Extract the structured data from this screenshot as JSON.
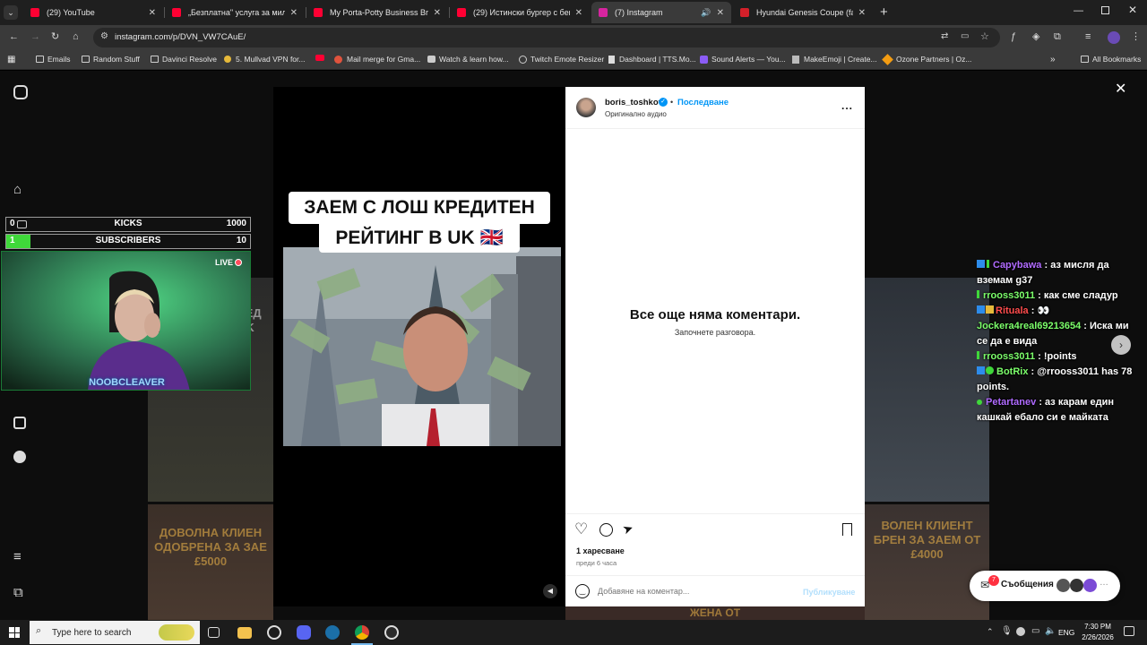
{
  "tabs": [
    {
      "label": "(29) YouTube",
      "color": "#ff0033"
    },
    {
      "label": "„Безплатна\" услуга за милион...",
      "color": "#ff0033"
    },
    {
      "label": "My Porta-Potty Business Brings...",
      "color": "#ff0033"
    },
    {
      "label": "(29) Истински бургер с бекон...",
      "color": "#ff0033"
    },
    {
      "label": "(7) Instagram",
      "color": "#d6249f"
    },
    {
      "label": "Hyundai Genesis Coupe (facelift...",
      "color": "#d4202a"
    }
  ],
  "new_tab": "+",
  "address": {
    "url": "instagram.com/p/DVN_VW7CAuE/"
  },
  "bookmarks": [
    "Emails",
    "Random Stuff",
    "Davinci Resolve",
    "5. Mullvad VPN for...",
    "Mail merge for Gma...",
    "Watch & learn how...",
    "Twitch Emote Resizer",
    "Dashboard | TTS.Mo...",
    "Sound Alerts — You...",
    "MakeEmoji | Create...",
    "Ozone Partners | Oz..."
  ],
  "bookmarks_all": "All Bookmarks",
  "reel": {
    "caption_line1": "ЗАЕМ С ЛОШ КРЕДИТЕН",
    "caption_line2": "РЕЙТИНГ В UK 🇬🇧"
  },
  "post": {
    "username": "boris_toshkov",
    "separator": "•",
    "follow": "Последване",
    "audio": "Оригинално аудио",
    "more": "...",
    "no_comments": "Все още няма коментари.",
    "start_conversation": "Започнете разговора.",
    "likes": "1 харесване",
    "time": "преди 6 часа",
    "comment_placeholder": "Добавяне на коментар...",
    "publish": "Публикуване"
  },
  "background_tiles": {
    "left_text": [
      "ДОВОЛНА КЛИЕН",
      "ОДОБРЕНА ЗА ЗАЕ",
      "£5000"
    ],
    "right_text": [
      "ВОЛЕН КЛИЕНТ",
      "БРЕН ЗА ЗАЕМ ОТ",
      "£4000"
    ],
    "bottom_text": "ЖЕНА ОТ",
    "partial_left": [
      "РЕД",
      "UK"
    ]
  },
  "messages": {
    "label": "Съобщения",
    "badge": "7"
  },
  "stream": {
    "kicks_count": "0",
    "kicks_label": "KICKS",
    "kicks_goal": "1000",
    "subs_count": "1",
    "subs_label": "SUBSCRIBERS",
    "subs_goal": "10",
    "live": "LIVE",
    "streamer": "NOOBCLEAVER"
  },
  "chat": [
    {
      "user": "Capybawa",
      "color": "#b06bff",
      "text": "аз мисля да вземам g37"
    },
    {
      "user": "rrooss3011",
      "color": "#7cff6b",
      "text": "как сме сладур"
    },
    {
      "user": "Rituala",
      "color": "#ff4d4d",
      "text": "👀"
    },
    {
      "user": "Jockera4real69213654",
      "color": "#7cff6b",
      "text": "Иска ми се да е вида"
    },
    {
      "user": "rrooss3011",
      "color": "#7cff6b",
      "text": "!points"
    },
    {
      "user": "BotRix",
      "color": "#7cff6b",
      "text": "@rrooss3011 has 78 points."
    },
    {
      "user": "Petartanev",
      "color": "#b06bff",
      "text": "аз карам един кашкай ебало си е майката"
    }
  ],
  "taskbar": {
    "search_placeholder": "Type here to search",
    "lang": "ENG",
    "time": "7:30 PM",
    "date": "2/26/2026"
  }
}
